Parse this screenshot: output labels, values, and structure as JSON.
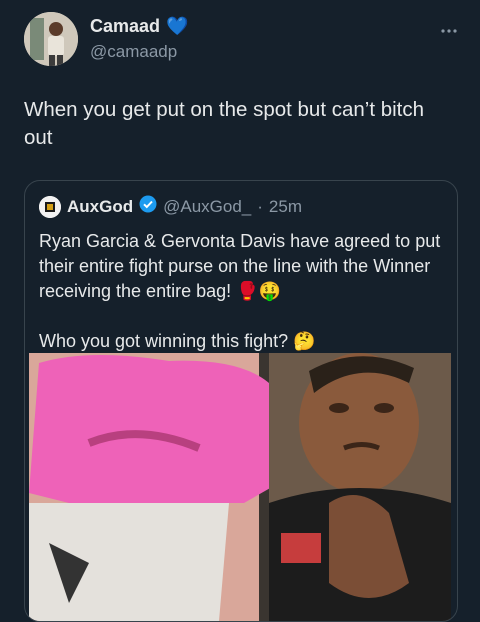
{
  "author": {
    "display_name": "Camaad",
    "handle": "@camaadp",
    "badge_emoji": "💙"
  },
  "tweet": {
    "text": "When you get put on the spot but can’t bitch out"
  },
  "more_icon": "more-horizontal-icon",
  "quoted": {
    "display_name": "AuxGod",
    "handle": "@AuxGod_",
    "separator": "·",
    "time": "25m",
    "verified_color": "#1d9bf0",
    "paragraph1": "Ryan Garcia & Gervonta Davis have agreed to put their entire fight purse on the line with the Winner receiving the entire bag!",
    "paragraph1_emojis": "🥊🤑",
    "paragraph2": "Who you got winning this fight?",
    "paragraph2_emoji": "🤔"
  },
  "colors": {
    "background": "#15202b",
    "text": "#e7e9ea",
    "secondary": "#8b98a5",
    "border": "#38444d"
  }
}
